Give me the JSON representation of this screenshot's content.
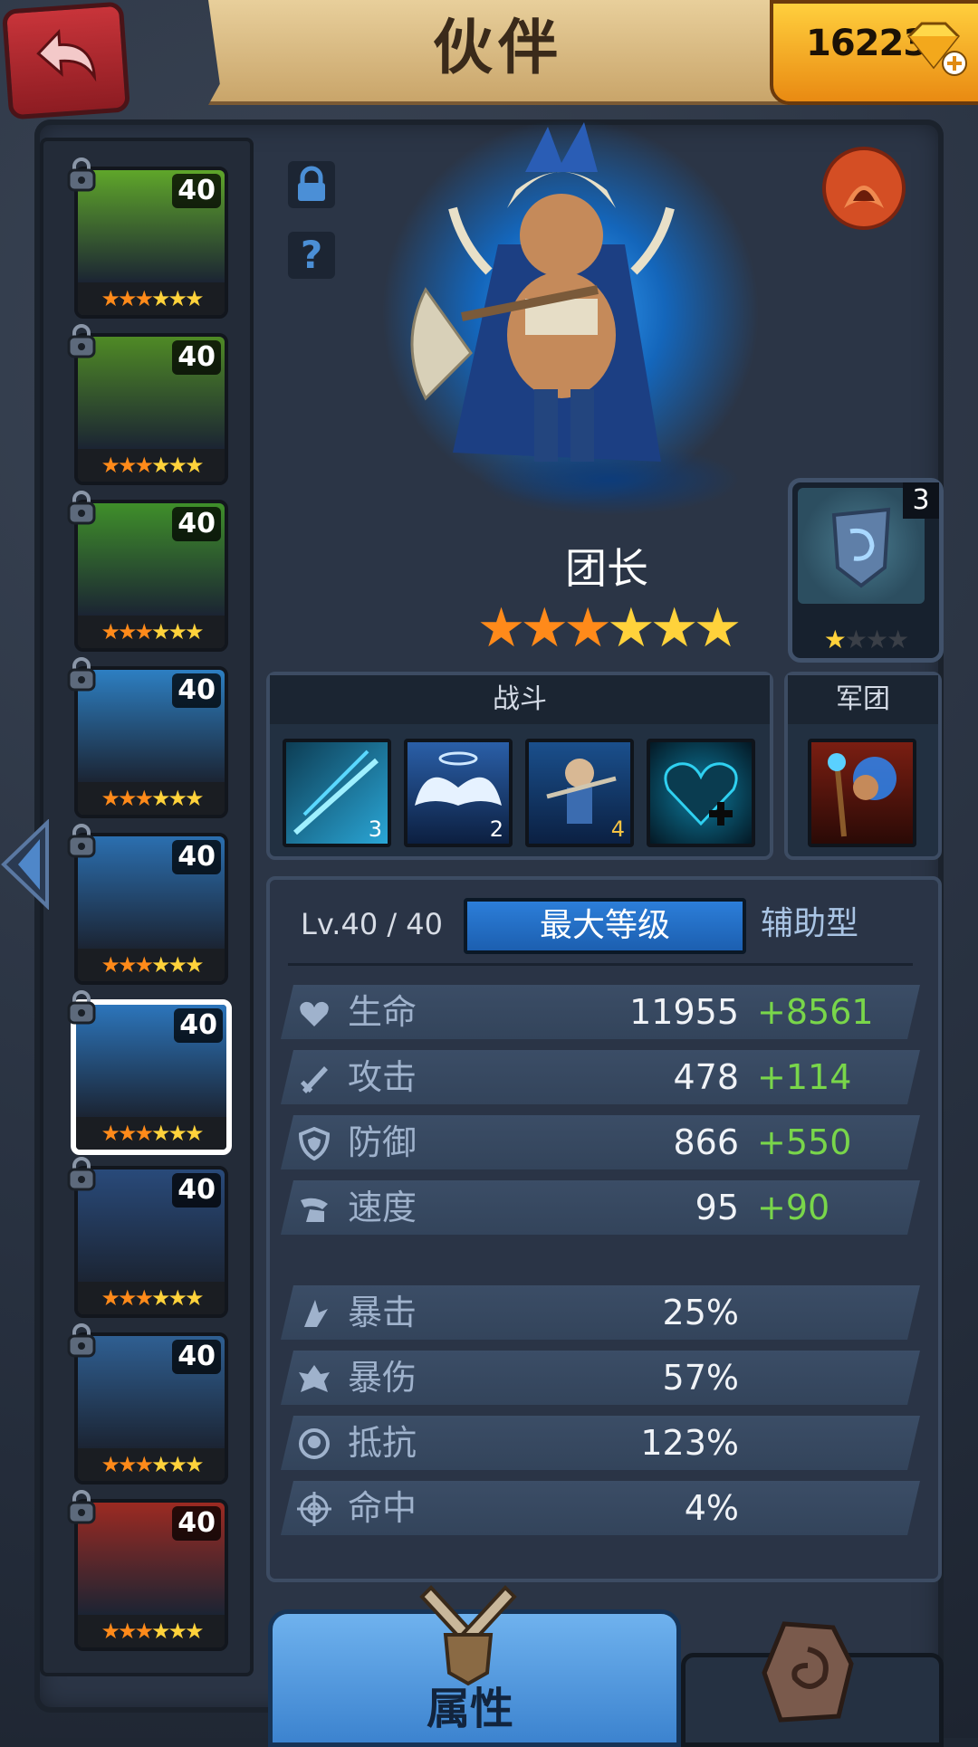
{
  "header": {
    "title": "伙伴",
    "gems": "16223"
  },
  "hero_list": [
    {
      "level": "40",
      "stars": 6,
      "orange_stars": 3,
      "color": "#5fa62a"
    },
    {
      "level": "40",
      "stars": 6,
      "orange_stars": 3,
      "color": "#4f8a25"
    },
    {
      "level": "40",
      "stars": 6,
      "orange_stars": 3,
      "color": "#3f8f2a"
    },
    {
      "level": "40",
      "stars": 6,
      "orange_stars": 3,
      "color": "#2d7fc2"
    },
    {
      "level": "40",
      "stars": 6,
      "orange_stars": 3,
      "color": "#2b6fb0"
    },
    {
      "level": "40",
      "stars": 6,
      "orange_stars": 3,
      "color": "#2c75bb",
      "selected": true
    },
    {
      "level": "40",
      "stars": 6,
      "orange_stars": 3,
      "color": "#294a7a"
    },
    {
      "level": "40",
      "stars": 6,
      "orange_stars": 3,
      "color": "#2f5f92"
    },
    {
      "level": "40",
      "stars": 6,
      "orange_stars": 3,
      "color": "#9c2a22"
    }
  ],
  "hero": {
    "name": "团长",
    "stars": 6,
    "orange_stars": 3
  },
  "rune": {
    "count": "3",
    "stars": 4,
    "filled_stars": 1
  },
  "skills": {
    "battle_title": "战斗",
    "legion_title": "军团",
    "battle": [
      {
        "icon": "slash-skill-icon",
        "level": "3"
      },
      {
        "icon": "wings-skill-icon",
        "level": "2"
      },
      {
        "icon": "hero-skill-icon",
        "level": "4"
      },
      {
        "icon": "heart-plus-skill-icon",
        "level": ""
      }
    ],
    "legion": {
      "icon": "legion-mage-icon"
    }
  },
  "stats": {
    "level_text": "Lv.40 / 40",
    "max_label": "最大等级",
    "role": "辅助型",
    "main": [
      {
        "icon": "heart-icon",
        "label": "生命",
        "value": "11955",
        "bonus": "+8561"
      },
      {
        "icon": "sword-icon",
        "label": "攻击",
        "value": "478",
        "bonus": "+114"
      },
      {
        "icon": "shield-icon",
        "label": "防御",
        "value": "866",
        "bonus": "+550"
      },
      {
        "icon": "wing-boot-icon",
        "label": "速度",
        "value": "95",
        "bonus": "+90"
      }
    ],
    "secondary": [
      {
        "icon": "crit-icon",
        "label": "暴击",
        "value": "25%"
      },
      {
        "icon": "crit-damage-icon",
        "label": "暴伤",
        "value": "57%"
      },
      {
        "icon": "resist-icon",
        "label": "抵抗",
        "value": "123%"
      },
      {
        "icon": "accuracy-icon",
        "label": "命中",
        "value": "4%"
      }
    ]
  },
  "tabs": {
    "attributes": "属性"
  }
}
